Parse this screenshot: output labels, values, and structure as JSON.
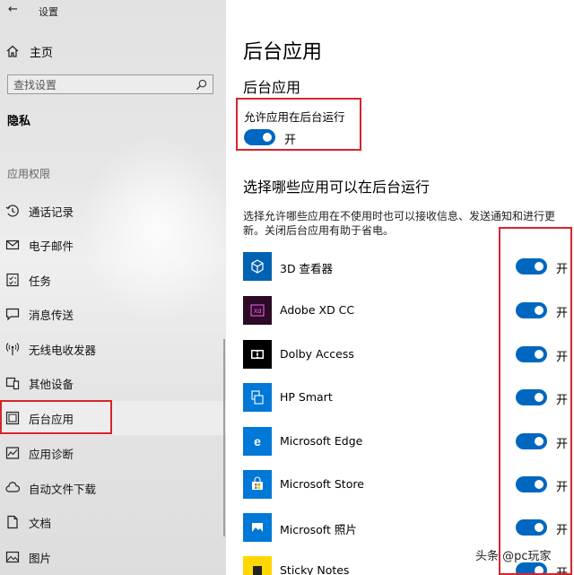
{
  "window": {
    "back_symbol": "←",
    "title": "设置"
  },
  "sidebar": {
    "home_label": "主页",
    "search_placeholder": "查找设置",
    "section_title": "隐私",
    "group_title": "应用权限",
    "items": [
      {
        "label": "通话记录",
        "icon": "call-history-icon"
      },
      {
        "label": "电子邮件",
        "icon": "mail-icon"
      },
      {
        "label": "任务",
        "icon": "tasks-icon"
      },
      {
        "label": "消息传送",
        "icon": "messaging-icon"
      },
      {
        "label": "无线电收发器",
        "icon": "radios-icon"
      },
      {
        "label": "其他设备",
        "icon": "other-devices-icon"
      },
      {
        "label": "后台应用",
        "icon": "background-apps-icon",
        "active": true
      },
      {
        "label": "应用诊断",
        "icon": "app-diagnostics-icon"
      },
      {
        "label": "自动文件下载",
        "icon": "cloud-download-icon"
      },
      {
        "label": "文档",
        "icon": "documents-icon"
      },
      {
        "label": "图片",
        "icon": "pictures-icon"
      }
    ]
  },
  "main": {
    "title": "后台应用",
    "subtitle": "后台应用",
    "allow_label": "允许应用在后台运行",
    "allow_state": "开",
    "choose_title": "选择哪些应用可以在后台运行",
    "description": "选择允许哪些应用在不使用时也可以接收信息、发送通知和进行更新。关闭后台应用有助于省电。",
    "apps": [
      {
        "name": "3D 查看器",
        "state": "开",
        "icon": "3d-viewer-icon",
        "tile": "#0063b1"
      },
      {
        "name": "Adobe XD CC",
        "state": "开",
        "icon": "adobe-xd-icon",
        "tile": "#2b0b25"
      },
      {
        "name": "Dolby Access",
        "state": "开",
        "icon": "dolby-icon",
        "tile": "#000000"
      },
      {
        "name": "HP Smart",
        "state": "开",
        "icon": "hp-smart-icon",
        "tile": "#0078d7"
      },
      {
        "name": "Microsoft Edge",
        "state": "开",
        "icon": "edge-icon",
        "tile": "#0078d7"
      },
      {
        "name": "Microsoft Store",
        "state": "开",
        "icon": "store-icon",
        "tile": "#0078d7"
      },
      {
        "name": "Microsoft 照片",
        "state": "开",
        "icon": "photos-icon",
        "tile": "#0078d7"
      },
      {
        "name": "Sticky Notes",
        "state": "开",
        "icon": "sticky-notes-icon",
        "tile": "#ffd700"
      }
    ]
  },
  "colors": {
    "accent": "#0067c0",
    "highlight_box": "#d8232a"
  },
  "watermark": "头条 @pc玩家"
}
